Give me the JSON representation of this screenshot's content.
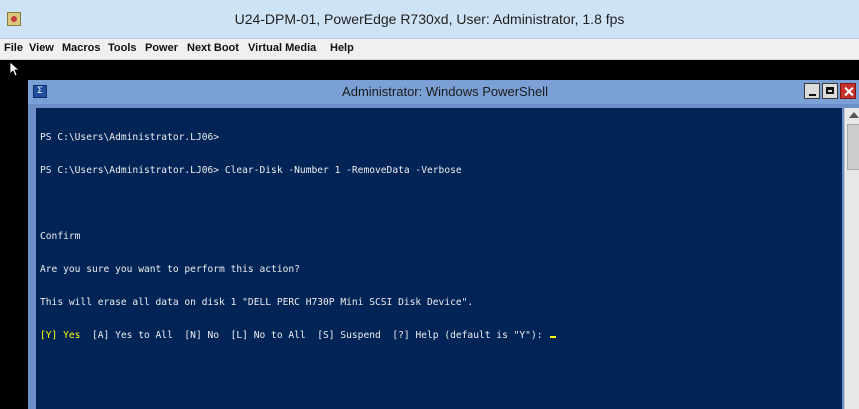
{
  "viewer": {
    "title": "U24-DPM-01, PowerEdge R730xd, User: Administrator, 1.8 fps",
    "menu": [
      "File",
      "View",
      "Macros",
      "Tools",
      "Power",
      "Next Boot",
      "Virtual Media",
      "Help"
    ]
  },
  "powershell": {
    "title": "Administrator: Windows PowerShell",
    "icon_glyph": "Σ",
    "lines": [
      "PS C:\\Users\\Administrator.LJ06>",
      "PS C:\\Users\\Administrator.LJ06> Clear-Disk -Number 1 -RemoveData -Verbose"
    ],
    "confirm_heading": "Confirm",
    "question": "Are you sure you want to perform this action?",
    "warning": "This will erase all data on disk 1 \"DELL PERC H730P Mini SCSI Disk Device\".",
    "prompt_default": "[Y] Yes",
    "prompt_rest": "  [A] Yes to All  [N] No  [L] No to All  [S] Suspend  [?] Help (default is \"Y\"): "
  },
  "colors": {
    "console_bg": "#012456",
    "console_text": "#eeedf0",
    "prompt_highlight": "#ffff00",
    "viewer_titlebar": "#cfe3f6",
    "ps_frame": "#6c8fc9"
  }
}
